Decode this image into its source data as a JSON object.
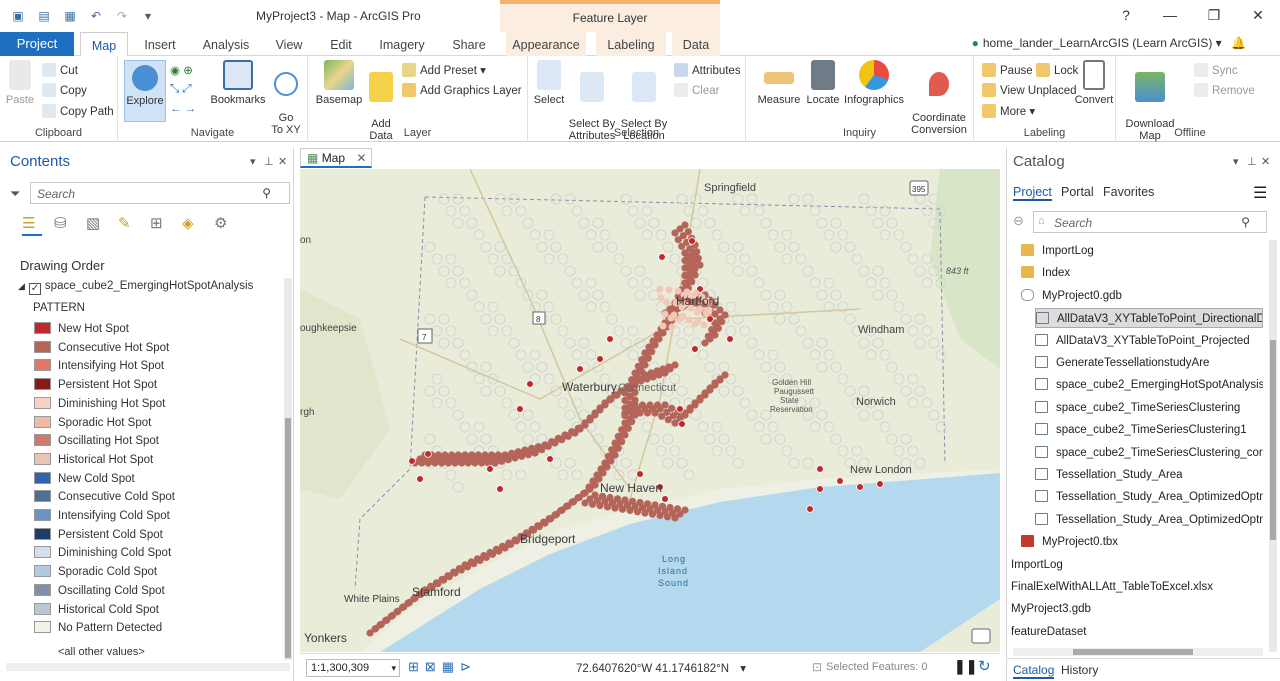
{
  "window": {
    "title": "MyProject3 - Map - ArcGIS Pro",
    "context_tab_group": "Feature Layer",
    "controls": [
      "?",
      "—",
      "❐",
      "✕"
    ]
  },
  "ribbon_tabs": {
    "project": "Project",
    "tabs": [
      "Map",
      "Insert",
      "Analysis",
      "View",
      "Edit",
      "Imagery",
      "Share",
      "Appearance",
      "Labeling",
      "Data"
    ],
    "user": "home_lander_LearnArcGIS (Learn ArcGIS)"
  },
  "ribbon": {
    "clipboard": {
      "name": "Clipboard",
      "paste": "Paste",
      "cut": "Cut",
      "copy": "Copy",
      "copy_path": "Copy Path"
    },
    "navigate": {
      "name": "Navigate",
      "explore": "Explore",
      "bookmarks": "Bookmarks",
      "goto": "Go\nTo XY"
    },
    "layer": {
      "name": "Layer",
      "basemap": "Basemap",
      "add_data": "Add\nData",
      "add_preset": "Add Preset",
      "add_graphics": "Add Graphics Layer"
    },
    "selection": {
      "name": "Selection",
      "select": "Select",
      "select_by_attr": "Select By\nAttributes",
      "select_by_loc": "Select By\nLocation",
      "attributes": "Attributes",
      "clear": "Clear"
    },
    "inquiry": {
      "name": "Inquiry",
      "measure": "Measure",
      "locate": "Locate",
      "infographics": "Infographics",
      "coord_conv": "Coordinate\nConversion"
    },
    "labeling": {
      "name": "Labeling",
      "pause": "Pause",
      "lock": "Lock",
      "view_unplaced": "View Unplaced",
      "more": "More",
      "convert": "Convert"
    },
    "offline": {
      "name": "Offline",
      "download": "Download\nMap",
      "sync": "Sync",
      "remove": "Remove"
    }
  },
  "contents": {
    "title": "Contents",
    "search_placeholder": "Search",
    "drawing_order": "Drawing Order",
    "layer_name": "space_cube2_EmergingHotSpotAnalysis",
    "field": "PATTERN",
    "legend": [
      {
        "label": "New Hot Spot",
        "color": "#c0282a"
      },
      {
        "label": "Consecutive Hot Spot",
        "color": "#b5645a"
      },
      {
        "label": "Intensifying Hot Spot",
        "color": "#e07768"
      },
      {
        "label": "Persistent Hot Spot",
        "color": "#8a1a14"
      },
      {
        "label": "Diminishing Hot Spot",
        "color": "#f6d4c4"
      },
      {
        "label": "Sporadic Hot Spot",
        "color": "#f2b9a6"
      },
      {
        "label": "Oscillating Hot Spot",
        "color": "#cc7b70"
      },
      {
        "label": "Historical Hot Spot",
        "color": "#e7c6b8"
      },
      {
        "label": "New Cold Spot",
        "color": "#2e64b0"
      },
      {
        "label": "Consecutive Cold Spot",
        "color": "#4e6f94"
      },
      {
        "label": "Intensifying Cold Spot",
        "color": "#6d93c4"
      },
      {
        "label": "Persistent Cold Spot",
        "color": "#1c3c6a"
      },
      {
        "label": "Diminishing Cold Spot",
        "color": "#d4e0ee"
      },
      {
        "label": "Sporadic Cold Spot",
        "color": "#b5c8e2"
      },
      {
        "label": "Oscillating Cold Spot",
        "color": "#8090a8"
      },
      {
        "label": "Historical Cold Spot",
        "color": "#b9c6d3"
      },
      {
        "label": "No Pattern Detected",
        "color": "#f4f1ea"
      }
    ],
    "other_values": "<all other values>"
  },
  "map": {
    "tab_label": "Map",
    "scale": "1:1,300,309",
    "coordinates": "72.6407620°W 41.1746182°N",
    "selected_features": "Selected Features: 0",
    "labels": {
      "springfield": "Springfield",
      "hartford": "Hartford",
      "waterbury": "Waterbury",
      "connecticut": "Connecticut",
      "new_haven": "New Haven",
      "bridgeport": "Bridgeport",
      "stamford": "Stamford",
      "white_plains": "White Plains",
      "yonkers": "Yonkers",
      "windham": "Windham",
      "norwich": "Norwich",
      "new_london": "New London",
      "long_island_sound": "Long\nIsland\nSound",
      "poughkeepsie": "oughkeepsie",
      "golden_hill": "Golden Hill\nPaugussett\nState\nReservation",
      "elev": "843 ft",
      "left_on": "on",
      "left_rgh": "rgh",
      "shield_395": "395",
      "shield_8": "8",
      "shield_7": "7"
    }
  },
  "catalog": {
    "title": "Catalog",
    "tabs": [
      "Project",
      "Portal",
      "Favorites"
    ],
    "search_placeholder": "Search",
    "items": [
      {
        "label": "ImportLog",
        "icon": "folder-icon"
      },
      {
        "label": "Index",
        "icon": "folder-icon"
      },
      {
        "label": "MyProject0.gdb",
        "icon": "geodatabase-icon"
      },
      {
        "label": "AllDataV3_XYTableToPoint_DirectionalDis",
        "icon": "feature-class-icon"
      },
      {
        "label": "AllDataV3_XYTableToPoint_Projected",
        "icon": "point-feature-icon"
      },
      {
        "label": "GenerateTessellationstudyAre",
        "icon": "polygon-feature-icon"
      },
      {
        "label": "space_cube2_EmergingHotSpotAnalysis",
        "icon": "polygon-feature-icon"
      },
      {
        "label": "space_cube2_TimeSeriesClustering",
        "icon": "polygon-feature-icon"
      },
      {
        "label": "space_cube2_TimeSeriesClustering1",
        "icon": "polygon-feature-icon"
      },
      {
        "label": "space_cube2_TimeSeriesClustering_corro",
        "icon": "polygon-feature-icon"
      },
      {
        "label": "Tessellation_Study_Area",
        "icon": "polygon-feature-icon"
      },
      {
        "label": "Tessellation_Study_Area_OptimizedOptm",
        "icon": "polygon-feature-icon"
      },
      {
        "label": "Tessellation_Study_Area_OptimizedOptm",
        "icon": "polygon-feature-icon"
      },
      {
        "label": "MyProject0.tbx",
        "icon": "toolbox-icon"
      },
      {
        "label": "ImportLog",
        "icon": "none"
      },
      {
        "label": "FinalExelWithALLAtt_TableToExcel.xlsx",
        "icon": "none"
      },
      {
        "label": "MyProject3.gdb",
        "icon": "none"
      },
      {
        "label": "featureDataset",
        "icon": "none"
      }
    ],
    "bottom_tabs": [
      "Catalog",
      "History"
    ]
  }
}
